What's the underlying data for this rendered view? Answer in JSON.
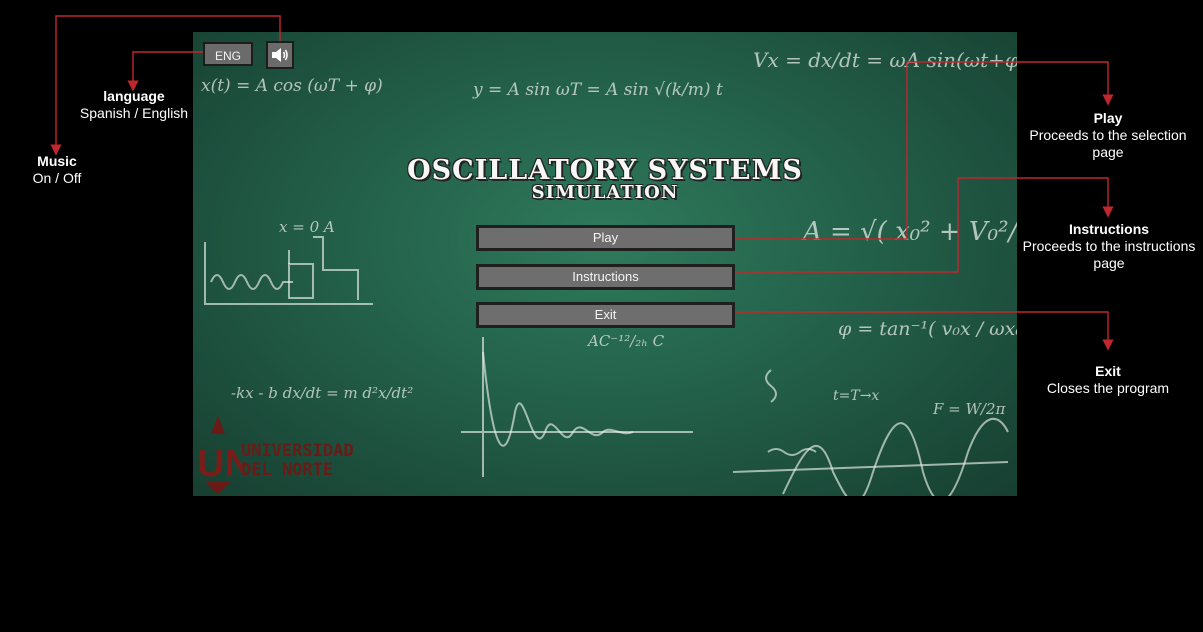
{
  "app": {
    "lang_button": "ENG",
    "sound_icon": "speaker-icon",
    "title_line1": "OSCILLATORY SYSTEMS",
    "title_line2": "SIMULATION",
    "buttons": {
      "play": "Play",
      "instructions": "Instructions",
      "exit": "Exit"
    },
    "logo": {
      "mark": "UN",
      "line1": "UNIVERSIDAD",
      "line2": "DEL NORTE"
    }
  },
  "annotations": {
    "music": {
      "title": "Music",
      "desc": "On / Off"
    },
    "language": {
      "title": "language",
      "desc": "Spanish / English"
    },
    "play": {
      "title": "Play",
      "desc1": "Proceeds to the selection",
      "desc2": "page"
    },
    "instructions": {
      "title": "Instructions",
      "desc1": "Proceeds to the instructions",
      "desc2": "page"
    },
    "exit": {
      "title": "Exit",
      "desc": "Closes the program"
    }
  },
  "colors": {
    "connector": "#c0272d",
    "board": "#23604a",
    "button": "#6e6e6e",
    "logo": "#6a1b16"
  }
}
